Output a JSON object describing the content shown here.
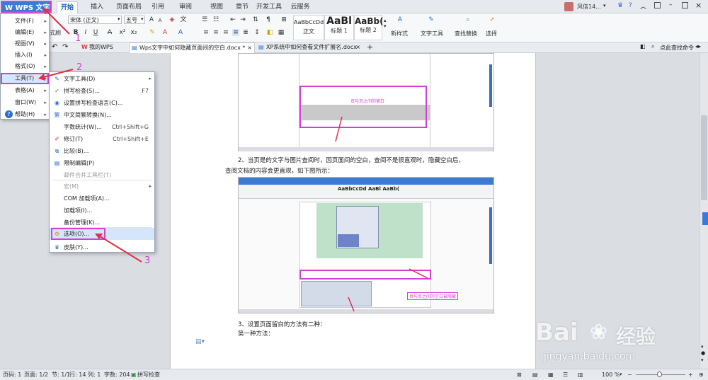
{
  "app": {
    "logo": "WPS 文字",
    "logo_caret": "▾"
  },
  "ribbon_tabs": [
    "开始",
    "插入",
    "页面布局",
    "引用",
    "审阅",
    "视图",
    "章节",
    "开发工具",
    "云服务"
  ],
  "user": {
    "name": "风信14..."
  },
  "ribbon": {
    "paste_label": "式刷",
    "font_name": "宋体 (正文)",
    "font_size": "五号",
    "styles": [
      {
        "preview": "AaBbCcDd",
        "name": "正文"
      },
      {
        "preview": "AaBl",
        "name": "标题 1"
      },
      {
        "preview": "AaBb(",
        "name": "标题 2"
      }
    ],
    "new_style": "新样式",
    "text_tools": "文字工具",
    "find_replace": "查找替换",
    "select": "选择"
  },
  "doc_tabs": [
    "我的WPS",
    "Wps文字中如何隐藏页面间的空白.docx *",
    "XP系统中如何查看文件扩展名.docx"
  ],
  "right_tools": {
    "search": "点此查找命令"
  },
  "main_menu": [
    {
      "label": "文件(F)"
    },
    {
      "label": "编辑(E)"
    },
    {
      "label": "视图(V)"
    },
    {
      "label": "插入(I)"
    },
    {
      "label": "格式(O)"
    },
    {
      "label": "工具(T)"
    },
    {
      "label": "表格(A)"
    },
    {
      "label": "窗口(W)"
    },
    {
      "label": "帮助(H)"
    }
  ],
  "tools_menu": [
    {
      "label": "文字工具(D)",
      "shortcut": "",
      "icon": "text-tools-icon",
      "glyph": "✎",
      "color": "#2b6fd1",
      "disabled": false,
      "submenu": true
    },
    {
      "label": "拼写检查(S)...",
      "shortcut": "F7",
      "icon": "spellcheck-icon",
      "glyph": "✓",
      "color": "#2b8a2b",
      "disabled": false,
      "submenu": false
    },
    {
      "label": "设置拼写检查语言(C)...",
      "shortcut": "",
      "icon": "language-icon",
      "glyph": "◉",
      "color": "#2b6fd1",
      "disabled": false,
      "submenu": false
    },
    {
      "label": "中文简繁转换(N)...",
      "shortcut": "",
      "icon": "convert-icon",
      "glyph": "繁",
      "color": "#2b6fd1",
      "disabled": false,
      "submenu": false
    },
    {
      "label": "字数统计(W)...",
      "shortcut": "Ctrl+Shift+G",
      "icon": "",
      "glyph": "",
      "color": "",
      "disabled": false,
      "submenu": false
    },
    {
      "label": "修订(T)",
      "shortcut": "Ctrl+Shift+E",
      "icon": "revise-icon",
      "glyph": "✐",
      "color": "#d04040",
      "disabled": false,
      "submenu": false
    },
    {
      "label": "比较(B)...",
      "shortcut": "",
      "icon": "compare-icon",
      "glyph": "⧉",
      "color": "#2b6fd1",
      "disabled": false,
      "submenu": false
    },
    {
      "label": "限制编辑(P)",
      "shortcut": "",
      "icon": "restrict-icon",
      "glyph": "▤",
      "color": "#2b6fd1",
      "disabled": false,
      "submenu": false
    },
    {
      "label": "邮件合并工具栏(T)",
      "shortcut": "",
      "icon": "",
      "glyph": "",
      "color": "",
      "disabled": true,
      "submenu": false
    },
    {
      "label": "宏(M)",
      "shortcut": "",
      "icon": "",
      "glyph": "",
      "color": "",
      "disabled": true,
      "submenu": true
    },
    {
      "label": "COM 加载项(A)...",
      "shortcut": "",
      "icon": "",
      "glyph": "",
      "color": "",
      "disabled": false,
      "submenu": false
    },
    {
      "label": "加载项(I)...",
      "shortcut": "",
      "icon": "",
      "glyph": "",
      "color": "",
      "disabled": false,
      "submenu": false
    },
    {
      "label": "备份管理(K)...",
      "shortcut": "",
      "icon": "",
      "glyph": "",
      "color": "",
      "disabled": false,
      "submenu": false
    },
    {
      "label": "选项(O)...",
      "shortcut": "",
      "icon": "options-icon",
      "glyph": "⚙",
      "color": "#e08a1a",
      "disabled": false,
      "submenu": false
    },
    {
      "label": "皮肤(Y)...",
      "shortcut": "",
      "icon": "skin-icon",
      "glyph": "♛",
      "color": "#2b6fd1",
      "disabled": false,
      "submenu": false
    }
  ],
  "steps": [
    "1",
    "2",
    "3"
  ],
  "document": {
    "para1": "2、当页是的文字与图片查阅时，因页面间的空白，查阅不是很直观时，隐藏空白后，",
    "para2": "查阅文档的内容会更直观，如下图所示：",
    "para3": "3、设置页面留白的方法有二种：",
    "para4": "第一种方法：",
    "shot1_caption": "页与页之间的留白",
    "shot2_caption": "页与页之间的空白被隐藏",
    "shot2_mini_style": "AaBbCcDd  AaBl  AaBb("
  },
  "status": {
    "page": "页码: 1",
    "pages": "页面: 1/2",
    "section": "节: 1/1",
    "row": "行: 14",
    "col": "列: 1",
    "words": "字数: 204",
    "spell": "拼写检查",
    "zoom": "100 %"
  },
  "watermark": {
    "brand": "Bai",
    "brand2": "经验",
    "url": "jingyan.baidu.com"
  }
}
